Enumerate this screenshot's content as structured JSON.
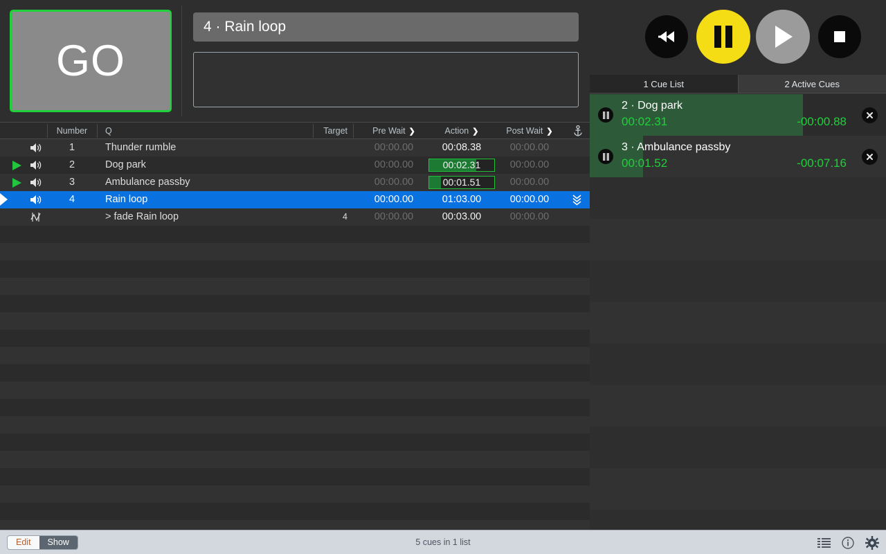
{
  "go_button": {
    "label": "GO"
  },
  "inspector": {
    "title": "4 · Rain loop",
    "notes_value": ""
  },
  "table": {
    "headers": {
      "number": "Number",
      "q": "Q",
      "target": "Target",
      "pre_wait": "Pre Wait",
      "action": "Action",
      "post_wait": "Post Wait",
      "anchor_icon": "anchor-icon"
    },
    "rows": [
      {
        "number": "1",
        "name": "Thunder rumble",
        "target": "",
        "pre_wait": "00:00.00",
        "action": "00:08.38",
        "post_wait": "00:00.00",
        "type_icon": "speaker-icon",
        "playing": false,
        "selected": false,
        "progress": null,
        "continue_icon": ""
      },
      {
        "number": "2",
        "name": "Dog park",
        "target": "",
        "pre_wait": "00:00.00",
        "action": "00:02.31",
        "post_wait": "00:00.00",
        "type_icon": "speaker-icon",
        "playing": true,
        "selected": false,
        "progress": 72,
        "continue_icon": ""
      },
      {
        "number": "3",
        "name": "Ambulance passby",
        "target": "",
        "pre_wait": "00:00.00",
        "action": "00:01.51",
        "post_wait": "00:00.00",
        "type_icon": "speaker-icon",
        "playing": true,
        "selected": false,
        "progress": 18,
        "continue_icon": ""
      },
      {
        "number": "4",
        "name": "Rain loop",
        "target": "",
        "pre_wait": "00:00.00",
        "action": "01:03.00",
        "post_wait": "00:00.00",
        "type_icon": "speaker-icon",
        "playing": false,
        "selected": true,
        "progress": null,
        "continue_icon": "continue-chevrons-icon"
      },
      {
        "number": "",
        "name": "> fade Rain loop",
        "target": "4",
        "pre_wait": "00:00.00",
        "action": "00:03.00",
        "post_wait": "00:00.00",
        "type_icon": "fade-curve-icon",
        "playing": false,
        "selected": false,
        "progress": null,
        "continue_icon": ""
      }
    ]
  },
  "transport": {
    "rewind_icon": "rewind-icon",
    "pause_icon": "pause-icon",
    "play_icon": "play-icon",
    "stop_icon": "stop-icon",
    "colors": {
      "pause": "#f5dd15",
      "play": "#9b9b9b",
      "button_dark": "#0a0a0a"
    }
  },
  "tabs": [
    {
      "label": "1 Cue List",
      "active": false
    },
    {
      "label": "2 Active Cues",
      "active": true
    }
  ],
  "active_cues": [
    {
      "title": "2 · Dog park",
      "elapsed": "00:02.31",
      "remaining": "-00:00.88",
      "progress": 72,
      "pause_icon": "pause-icon",
      "close_icon": "close-icon"
    },
    {
      "title": "3 · Ambulance passby",
      "elapsed": "00:01.52",
      "remaining": "-00:07.16",
      "progress": 18,
      "pause_icon": "pause-icon",
      "close_icon": "close-icon"
    }
  ],
  "bottom_bar": {
    "edit_label": "Edit",
    "show_label": "Show",
    "status": "5 cues in 1 list",
    "icons": [
      "list-icon",
      "info-icon",
      "gear-icon"
    ]
  },
  "colors": {
    "accent_green": "#1fd13a",
    "selection_blue": "#0a71e0",
    "active_green_bg": "#2d5a38"
  }
}
